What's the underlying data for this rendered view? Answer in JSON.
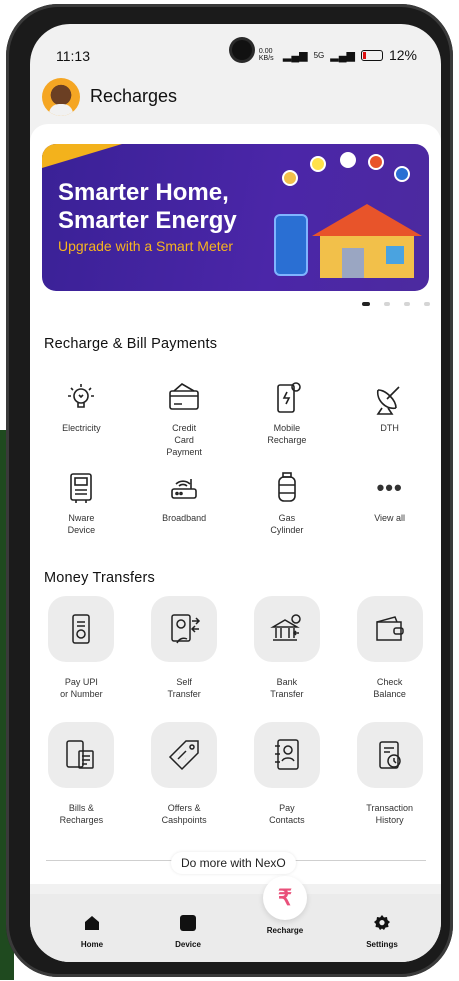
{
  "status_bar": {
    "time": "11:13",
    "speed": "0.00 KB/s",
    "network": "5G",
    "battery": "12%"
  },
  "header": {
    "title": "Recharges"
  },
  "banner": {
    "headline": "Smarter Home,\nSmarter Energy",
    "subline": "Upgrade with a Smart Meter",
    "colors": {
      "background": "#4b26a8",
      "accent": "#f3b21c"
    }
  },
  "carousel": {
    "pages": 4,
    "active_index": 0
  },
  "recharge_section": {
    "title": "Recharge & Bill Payments",
    "items": [
      {
        "label": "Electricity",
        "icon": "bulb-icon"
      },
      {
        "label": "Credit\nCard\nPayment",
        "icon": "credit-card-icon"
      },
      {
        "label": "Mobile\nRecharge",
        "icon": "mobile-icon"
      },
      {
        "label": "DTH",
        "icon": "satellite-dish-icon"
      },
      {
        "label": "Nware\nDevice",
        "icon": "meter-device-icon"
      },
      {
        "label": "Broadband",
        "icon": "router-icon"
      },
      {
        "label": "Gas\nCylinder",
        "icon": "gas-cylinder-icon"
      },
      {
        "label": "View all",
        "icon": "more-dots-icon"
      }
    ]
  },
  "money_section": {
    "title": "Money Transfers",
    "items": [
      {
        "label": "Pay UPI\nor Number",
        "icon": "upi-phone-icon"
      },
      {
        "label": "Self\nTransfer",
        "icon": "self-transfer-icon"
      },
      {
        "label": "Bank\nTransfer",
        "icon": "bank-icon"
      },
      {
        "label": "Check\nBalance",
        "icon": "wallet-icon"
      },
      {
        "label": "Bills &\nRecharges",
        "icon": "bills-icon"
      },
      {
        "label": "Offers &\nCashpoints",
        "icon": "tag-icon"
      },
      {
        "label": "Pay\nContacts",
        "icon": "contacts-icon"
      },
      {
        "label": "Transaction\nHistory",
        "icon": "history-icon"
      }
    ]
  },
  "do_more": {
    "label": "Do more with NexO"
  },
  "bottom_nav": {
    "home": "Home",
    "device": "Device",
    "recharge": "Recharge",
    "settings": "Settings",
    "recharge_symbol": "₹"
  }
}
